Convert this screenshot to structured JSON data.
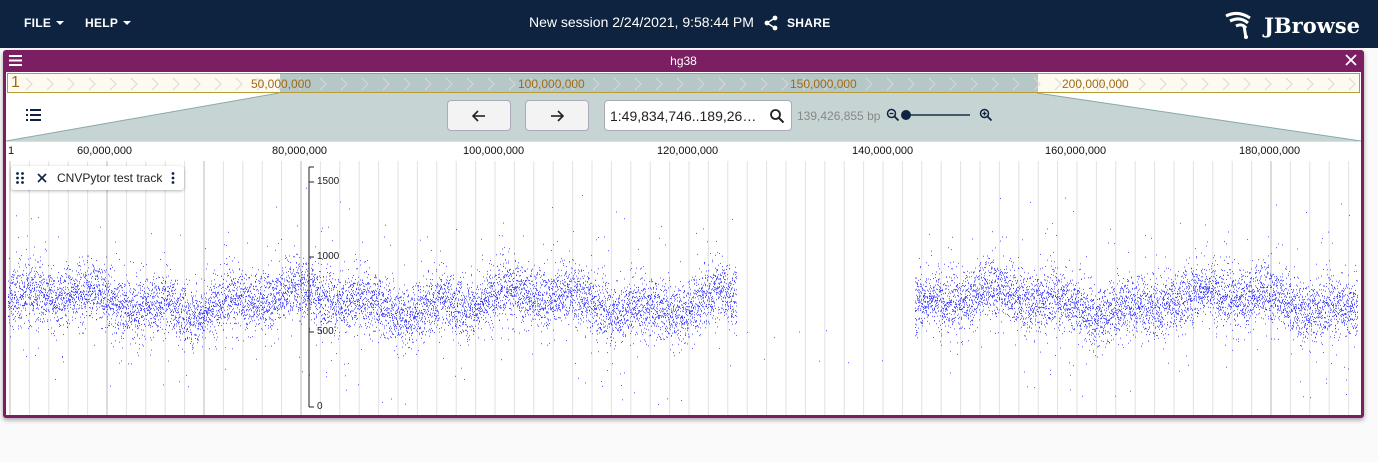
{
  "header": {
    "file_menu": "FILE",
    "help_menu": "HELP",
    "session_title": "New session 2/24/2021, 9:58:44 PM",
    "share_label": "SHARE",
    "logo_text": "JBrowse",
    "bg_color": "#0d233f"
  },
  "view": {
    "assembly": "hg38",
    "accent_color": "#7b1e62",
    "overview": {
      "chrom": "1",
      "labels": [
        "50,000,000",
        "100,000,000",
        "150,000,000",
        "200,000,000"
      ]
    },
    "nav": {
      "back_icon": "arrow-left-icon",
      "forward_icon": "arrow-right-icon",
      "locstring": "1:49,834,746..189,261...",
      "bp_count": "139,426,855 bp"
    },
    "ruler": {
      "chrom": "1",
      "labels": [
        "60,000,000",
        "80,000,000",
        "100,000,000",
        "120,000,000",
        "140,000,000",
        "160,000,000",
        "180,000,000"
      ]
    },
    "track": {
      "name": "CNVPytor test track",
      "point_color": "#1a1aff",
      "y_ticks": [
        "1500",
        "1000",
        "500",
        "0"
      ],
      "y_range": [
        0,
        1600
      ],
      "data_range": {
        "start": 49834746,
        "end": 189261601
      },
      "gap": {
        "start": 125000000,
        "end": 143300000
      }
    }
  }
}
